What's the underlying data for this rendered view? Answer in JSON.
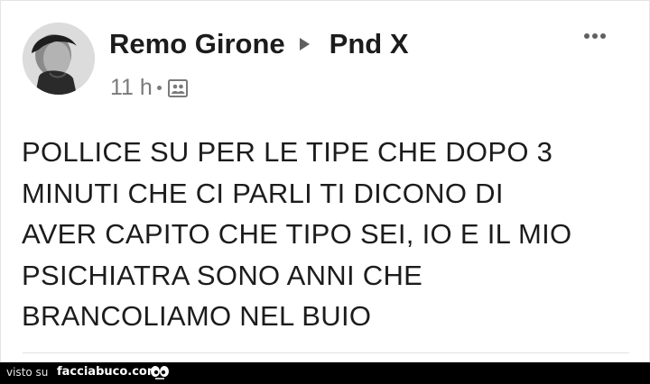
{
  "post": {
    "author": "Remo Girone",
    "group": "Pnd X",
    "time": "11 h",
    "text": "POLLICE SU PER LE TIPE CHE DOPO 3 MINUTI CHE CI PARLI TI DICONO DI AVER CAPITO CHE TIPO SEI, IO E IL MIO PSICHIATRA SONO ANNI CHE BRANCOLIAMO NEL BUIO",
    "text_lines": [
      "POLLICE SU PER LE TIPE CHE DOPO 3",
      "MINUTI CHE CI PARLI TI DICONO DI",
      "AVER CAPITO CHE TIPO SEI, IO E IL MIO",
      "PSICHIATRA SONO ANNI CHE",
      "BRANCOLIAMO NEL BUIO"
    ],
    "audience_icon": "group-audience-icon",
    "more_icon": "more-options-icon"
  },
  "watermark": {
    "prefix": "visto su",
    "site": "facciabuco.com",
    "logo_icon": "eyes-logo-icon"
  },
  "colors": {
    "text": "#1c1c1c",
    "meta": "#7a7a7a",
    "bar": "#000000"
  }
}
